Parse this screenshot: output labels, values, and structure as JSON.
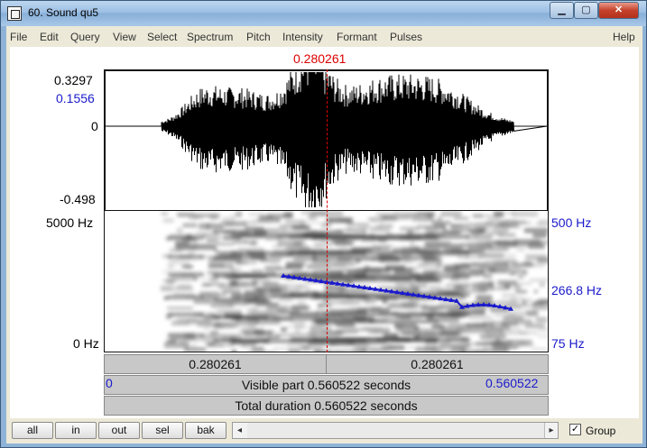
{
  "window": {
    "title": "60. Sound qu5",
    "controls": {
      "minimize": "▁",
      "maximize": "▢",
      "close": "✕"
    }
  },
  "menu": [
    "File",
    "Edit",
    "Query",
    "View",
    "Select",
    "Spectrum",
    "Pitch",
    "Intensity",
    "Formant",
    "Pulses",
    "Help"
  ],
  "editor": {
    "cursor_time": "0.280261",
    "waveform": {
      "y_top": "0.3297",
      "y_cursor_value": "0.1556",
      "y_zero": "0",
      "y_bottom": "-0.498"
    },
    "spectrogram": {
      "freq_top": "5000 Hz",
      "freq_bottom": "0 Hz",
      "pitch_top": "500 Hz",
      "pitch_mid": "266.8 Hz",
      "pitch_bottom": "75 Hz"
    },
    "time_bar": {
      "left": "0.280261",
      "right": "0.280261"
    },
    "visible": {
      "start": "0",
      "text": "Visible part 0.560522 seconds",
      "end": "0.560522"
    },
    "total": "Total duration 0.560522 seconds"
  },
  "controls": {
    "buttons": [
      "all",
      "in",
      "out",
      "sel",
      "bak"
    ],
    "group_label": "Group",
    "group_checked": true,
    "check_mark": "✓",
    "arrow_left": "◂",
    "arrow_right": "▸"
  },
  "colors": {
    "cursor": "#dd0000",
    "pitch": "#1a1acc",
    "title_bar": "#9dbfe3"
  }
}
